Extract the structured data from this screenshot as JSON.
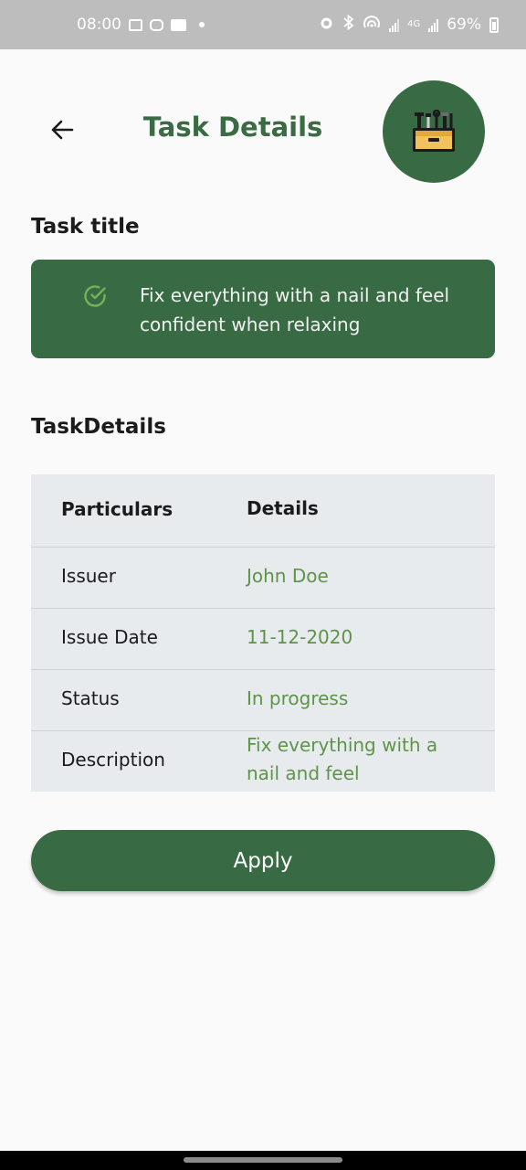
{
  "status_bar": {
    "time": "08:00",
    "network": "4G",
    "battery": "69%"
  },
  "header": {
    "title": "Task Details",
    "back_icon": "arrow-left-icon",
    "avatar_icon": "toolbox-icon"
  },
  "task_title_section": {
    "heading": "Task title",
    "task_text": "Fix everything with a nail and feel confident when relaxing",
    "check_icon": "check-circle-icon"
  },
  "task_details_section": {
    "heading": "TaskDetails",
    "table": {
      "headers": [
        "Particulars",
        "Details"
      ],
      "rows": [
        {
          "label": "Issuer",
          "value": "John Doe"
        },
        {
          "label": "Issue Date",
          "value": "11-12-2020"
        },
        {
          "label": "Status",
          "value": "In progress"
        },
        {
          "label": "Description",
          "value": "Fix everything with a nail and feel"
        }
      ]
    }
  },
  "apply_button": {
    "label": "Apply"
  },
  "colors": {
    "primary": "#386a43",
    "title_green": "#3a6b43",
    "value_green": "#5e9448",
    "table_bg": "#e7ebee",
    "page_bg": "#fafafa"
  }
}
